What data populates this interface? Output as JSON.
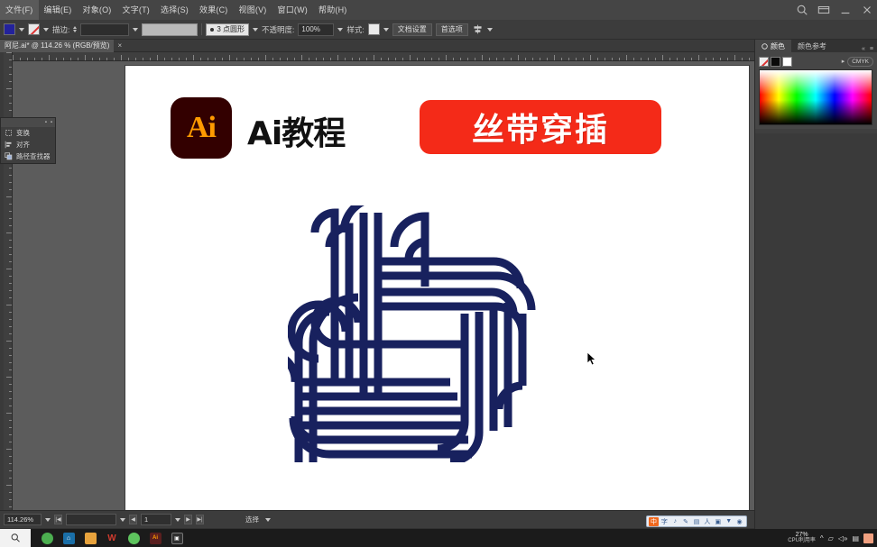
{
  "menubar": {
    "items": [
      {
        "label": "文件(F)"
      },
      {
        "label": "编辑(E)"
      },
      {
        "label": "对象(O)"
      },
      {
        "label": "文字(T)"
      },
      {
        "label": "选择(S)"
      },
      {
        "label": "效果(C)"
      },
      {
        "label": "视图(V)"
      },
      {
        "label": "窗口(W)"
      },
      {
        "label": "帮助(H)"
      }
    ],
    "icons": [
      "search-icon",
      "workspace-icon",
      "minimize-icon",
      "close-icon"
    ]
  },
  "control_bar": {
    "fill_label": "fill-swatch",
    "stroke_label": "stroke-swatch",
    "stroke_weight_label": "描边:",
    "stroke_weight_value": "",
    "stroke_profile": "",
    "stroke_style_value": "3 点圆形",
    "opacity_label": "不透明度:",
    "opacity_value": "100%",
    "style_label": "样式:",
    "doc_setup_button": "文档设置",
    "preferences_button": "首选项",
    "align_icon": "align-icon",
    "fill_color": "#23229c"
  },
  "tabbar": {
    "document_title": "阿尼.ai* @ 114.26 % (RGB/预览)",
    "close_glyph": "×"
  },
  "left_panel": {
    "title": "",
    "items": [
      {
        "label": "变换",
        "icon": "transform-icon"
      },
      {
        "label": "对齐",
        "icon": "align-icon"
      },
      {
        "label": "路径查找器",
        "icon": "pathfinder-icon"
      }
    ]
  },
  "right_dock": {
    "tabs": [
      {
        "label": "颜色",
        "active": true
      },
      {
        "label": "颜色参考",
        "active": false
      }
    ],
    "menu_glyph": "≡",
    "collapse_glyph": "«",
    "color_mode": "CMYK",
    "swatches": [
      "none",
      "black",
      "white"
    ]
  },
  "artboard": {
    "logo_text": "Ai",
    "title_text": "Ai教程",
    "banner_text": "丝带穿插",
    "banner_color": "#f42a18",
    "artwork_color": "#18215e",
    "artwork_name": "woven-ribbon-artwork"
  },
  "status_bar": {
    "zoom_value": "114.26%",
    "artboard_nav_value": "1",
    "tool_label": "选择",
    "prev_glyph": "◀",
    "next_glyph": "▶"
  },
  "ime_bar": {
    "icons": [
      "ime-mode-icon",
      "chinese-icon",
      "tone-icon",
      "handwriting-icon",
      "keyboard-icon",
      "person-icon",
      "panel-icon",
      "funnel-icon",
      "settings-icon"
    ]
  },
  "taskbar": {
    "start_icon": "search-icon",
    "apps": [
      {
        "name": "browser-icon",
        "color": "#4caf50",
        "glyph": ""
      },
      {
        "name": "app-blue-icon",
        "color": "#1a6fa8",
        "glyph": "⌂"
      },
      {
        "name": "file-explorer-icon",
        "color": "#e8a33d",
        "glyph": ""
      },
      {
        "name": "wps-icon",
        "color": "#c0392b",
        "glyph": "W"
      },
      {
        "name": "wechat-icon",
        "color": "#4caf50",
        "glyph": ""
      },
      {
        "name": "illustrator-icon",
        "color": "#5a1f1f",
        "glyph": "Ai"
      },
      {
        "name": "camera-icon",
        "color": "#2f2f2f",
        "glyph": "▣"
      }
    ],
    "cpu_percent": "27%",
    "cpu_label": "CPU利用率",
    "tray_glyphs": [
      "^",
      "🛡",
      "🔊",
      "▣"
    ]
  }
}
